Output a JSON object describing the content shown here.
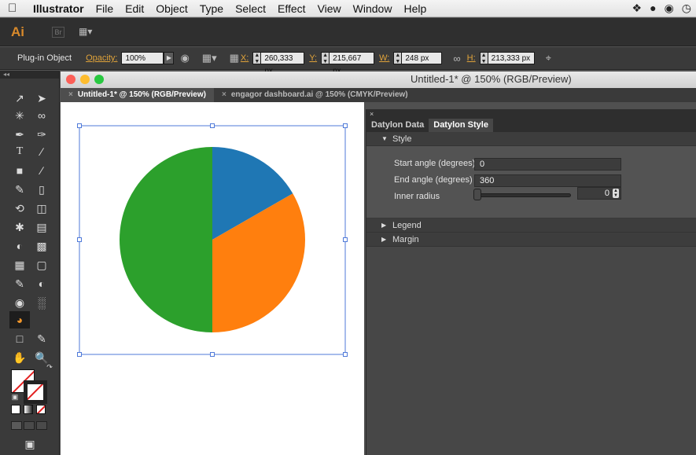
{
  "menubar": {
    "app": "Illustrator",
    "items": [
      "File",
      "Edit",
      "Object",
      "Type",
      "Select",
      "Effect",
      "View",
      "Window",
      "Help"
    ]
  },
  "appbar": {
    "logo": "Ai",
    "bridge": "Br"
  },
  "control_bar": {
    "selection": "Plug-in Object",
    "opacity_label": "Opacity:",
    "opacity_value": "100%",
    "x_label": "X:",
    "x_value": "260,333 px",
    "y_label": "Y:",
    "y_value": "215,667 px",
    "w_label": "W:",
    "w_value": "248 px",
    "h_label": "H:",
    "h_value": "213,333 px"
  },
  "document": {
    "window_title": "Untitled-1* @ 150% (RGB/Preview)",
    "tabs": [
      {
        "label": "Untitled-1* @ 150% (RGB/Preview)"
      },
      {
        "label": "engagor dashboard.ai @ 150% (CMYK/Preview)"
      }
    ]
  },
  "chart_data": {
    "type": "pie",
    "values": [
      16.7,
      33.3,
      50
    ],
    "colors": [
      "#1f77b4",
      "#ff7f0e",
      "#2ca02c"
    ],
    "start_angle": 0,
    "end_angle": 360
  },
  "panel": {
    "tabs": [
      "Datylon Data",
      "Datylon Style"
    ],
    "active_tab": "Datylon Style",
    "sections": {
      "style": "Style",
      "legend": "Legend",
      "margin": "Margin"
    },
    "style": {
      "start_angle_label": "Start angle (degrees)",
      "start_angle_value": "0",
      "end_angle_label": "End angle (degrees)",
      "end_angle_value": "360",
      "inner_radius_label": "Inner radius",
      "inner_radius_value": "0"
    }
  }
}
